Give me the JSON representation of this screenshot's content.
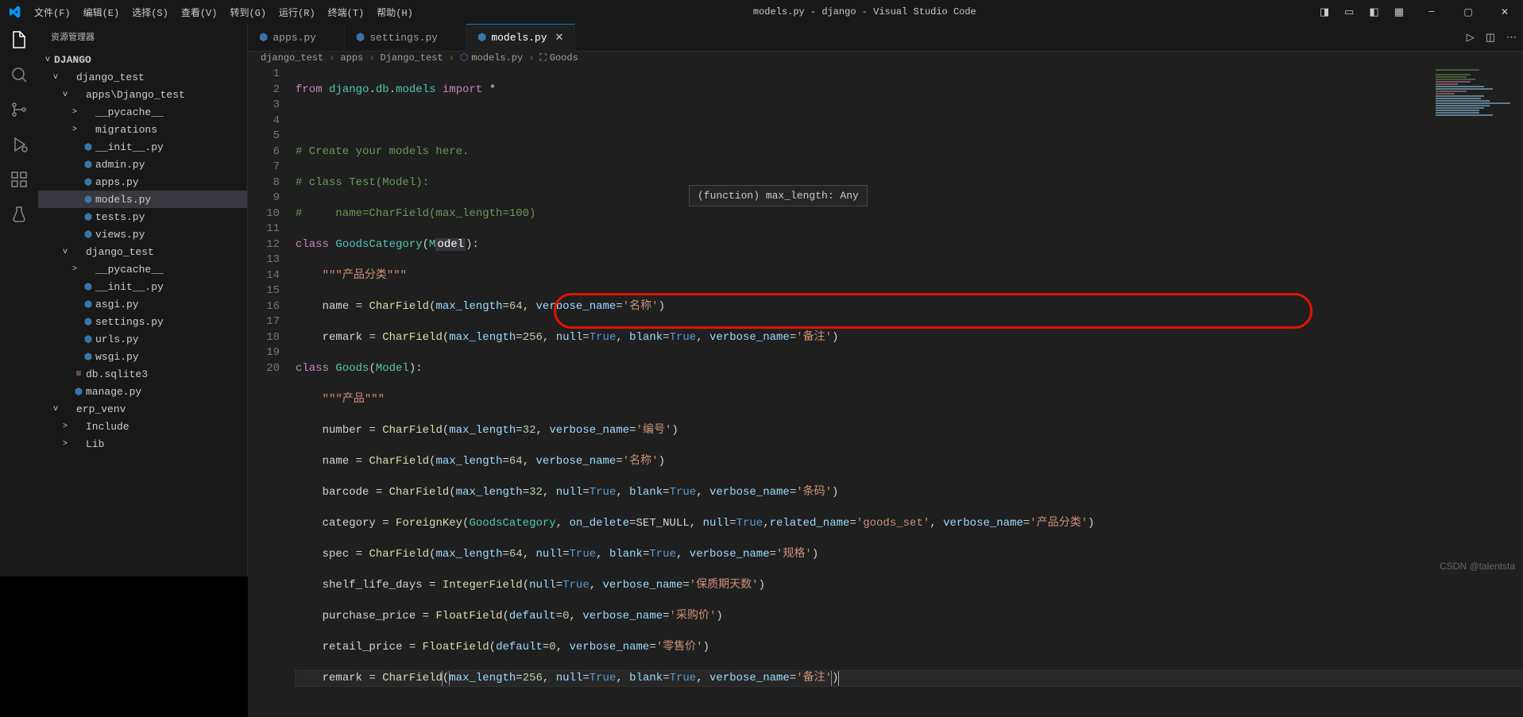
{
  "titlebar": {
    "menus": [
      "文件(F)",
      "编辑(E)",
      "选择(S)",
      "查看(V)",
      "转到(G)",
      "运行(R)",
      "终端(T)",
      "帮助(H)"
    ],
    "title": "models.py - django - Visual Studio Code"
  },
  "sidebar": {
    "title": "资源管理器",
    "root": "DJANGO",
    "tree": [
      {
        "ind": 1,
        "chev": "v",
        "icon": "",
        "label": "django_test",
        "color": ""
      },
      {
        "ind": 2,
        "chev": "v",
        "icon": "",
        "label": "apps\\Django_test",
        "color": ""
      },
      {
        "ind": 3,
        "chev": ">",
        "icon": "",
        "label": "__pycache__",
        "color": ""
      },
      {
        "ind": 3,
        "chev": ">",
        "icon": "",
        "label": "migrations",
        "color": ""
      },
      {
        "ind": 3,
        "chev": "",
        "icon": "py",
        "label": "__init__.py",
        "color": "py-icon"
      },
      {
        "ind": 3,
        "chev": "",
        "icon": "py",
        "label": "admin.py",
        "color": "py-icon"
      },
      {
        "ind": 3,
        "chev": "",
        "icon": "py",
        "label": "apps.py",
        "color": "py-icon"
      },
      {
        "ind": 3,
        "chev": "",
        "icon": "py",
        "label": "models.py",
        "color": "py-icon",
        "selected": true
      },
      {
        "ind": 3,
        "chev": "",
        "icon": "py",
        "label": "tests.py",
        "color": "py-icon"
      },
      {
        "ind": 3,
        "chev": "",
        "icon": "py",
        "label": "views.py",
        "color": "py-icon"
      },
      {
        "ind": 2,
        "chev": "v",
        "icon": "",
        "label": "django_test",
        "color": ""
      },
      {
        "ind": 3,
        "chev": ">",
        "icon": "",
        "label": "__pycache__",
        "color": ""
      },
      {
        "ind": 3,
        "chev": "",
        "icon": "py",
        "label": "__init__.py",
        "color": "py-icon"
      },
      {
        "ind": 3,
        "chev": "",
        "icon": "py",
        "label": "asgi.py",
        "color": "py-icon"
      },
      {
        "ind": 3,
        "chev": "",
        "icon": "py",
        "label": "settings.py",
        "color": "py-icon"
      },
      {
        "ind": 3,
        "chev": "",
        "icon": "py",
        "label": "urls.py",
        "color": "py-icon"
      },
      {
        "ind": 3,
        "chev": "",
        "icon": "py",
        "label": "wsgi.py",
        "color": "py-icon"
      },
      {
        "ind": 2,
        "chev": "",
        "icon": "db",
        "label": "db.sqlite3",
        "color": "db-icon"
      },
      {
        "ind": 2,
        "chev": "",
        "icon": "py",
        "label": "manage.py",
        "color": "py-icon"
      },
      {
        "ind": 1,
        "chev": "v",
        "icon": "",
        "label": "erp_venv",
        "color": ""
      },
      {
        "ind": 2,
        "chev": ">",
        "icon": "",
        "label": "Include",
        "color": ""
      },
      {
        "ind": 2,
        "chev": ">",
        "icon": "",
        "label": "Lib",
        "color": ""
      }
    ]
  },
  "tabs": [
    {
      "label": "apps.py",
      "active": false
    },
    {
      "label": "settings.py",
      "active": false
    },
    {
      "label": "models.py",
      "active": true
    }
  ],
  "breadcrumbs": [
    "django_test",
    "apps",
    "Django_test",
    "models.py",
    "Goods"
  ],
  "hover": "(function) max_length: Any",
  "code_lines_count": 20,
  "watermark": "CSDN @talentsta"
}
